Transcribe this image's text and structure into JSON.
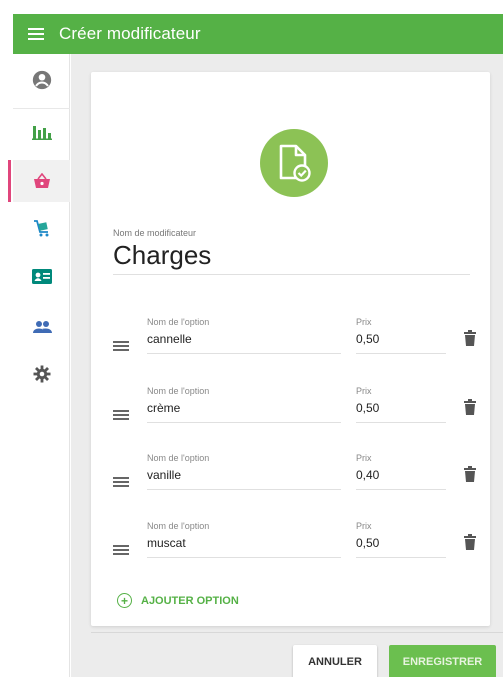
{
  "appbar": {
    "title": "Créer modificateur"
  },
  "sidebar": {
    "items": [
      {
        "name": "account-icon",
        "active": false
      },
      {
        "name": "bar-chart-icon",
        "active": false
      },
      {
        "name": "basket-icon",
        "active": true
      },
      {
        "name": "cart-icon",
        "active": false
      },
      {
        "name": "id-card-icon",
        "active": false
      },
      {
        "name": "people-icon",
        "active": false
      },
      {
        "name": "gear-icon",
        "active": false
      }
    ]
  },
  "form": {
    "modifier_label": "Nom de modificateur",
    "modifier_name": "Charges",
    "options": [
      {
        "name_label": "Nom de l'option",
        "name": "cannelle",
        "price_label": "Prix",
        "price": "0,50"
      },
      {
        "name_label": "Nom de l'option",
        "name": "crème",
        "price_label": "Prix",
        "price": "0,50"
      },
      {
        "name_label": "Nom de l'option",
        "name": "vanille",
        "price_label": "Prix",
        "price": "0,40"
      },
      {
        "name_label": "Nom de l'option",
        "name": "muscat",
        "price_label": "Prix",
        "price": "0,50"
      }
    ],
    "add_option_label": "AJOUTER OPTION"
  },
  "actions": {
    "cancel_label": "ANNULER",
    "save_label": "ENREGISTRER"
  },
  "colors": {
    "primary": "#55b146",
    "accent": "#e0467c",
    "sidebar_icon": "#43a047"
  }
}
